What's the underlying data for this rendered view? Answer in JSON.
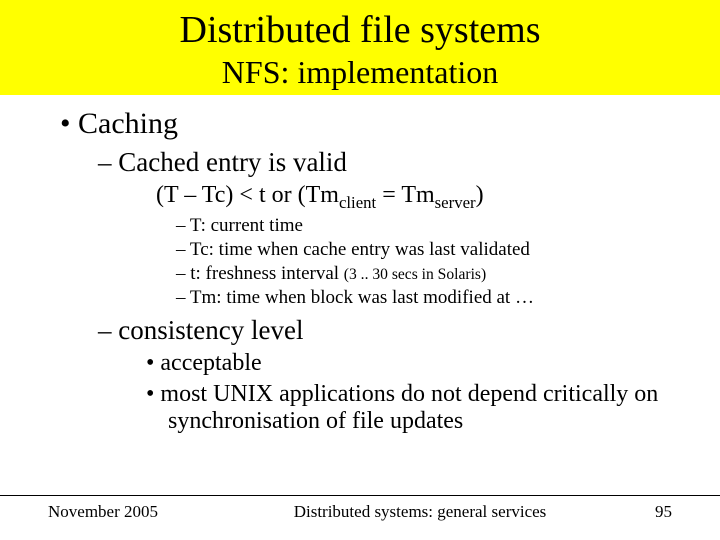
{
  "title": "Distributed file systems",
  "subtitle": "NFS: implementation",
  "bullets": {
    "caching": "Caching",
    "valid": "Cached entry is valid",
    "formula": {
      "p1": "(T – Tc) < t  or (Tm",
      "sub1": "client",
      "p2": " = Tm",
      "sub2": "server",
      "p3": ")"
    },
    "defs": {
      "t_cur": "T: current time",
      "tc": "Tc: time when cache entry was last validated",
      "t_small_a": "t:  freshness interval ",
      "t_small_b": "(3 .. 30 secs in Solaris)",
      "tm": "Tm: time when block was last modified at …"
    },
    "consistency": "consistency level",
    "cons_items": {
      "acceptable": "acceptable",
      "unix": "most UNIX applications do not depend critically on synchronisation of file updates"
    }
  },
  "footer": {
    "date": "November 2005",
    "center": "Distributed systems: general services",
    "page": "95"
  }
}
